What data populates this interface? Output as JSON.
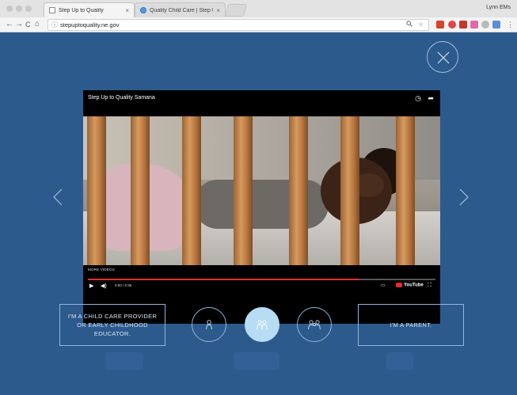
{
  "browser": {
    "tabs": [
      {
        "label": "Step Up to Quality",
        "active": true
      },
      {
        "label": "Quality Child Care | Step Up t",
        "active": false
      }
    ],
    "tab_close_glyph": "×",
    "user_name": "Lynn EMs",
    "nav": {
      "back": "←",
      "forward": "→",
      "reload": "C",
      "home": "⌂"
    },
    "info_glyph": "ⓘ",
    "url": "stepuptoquality.ne.gov",
    "menu_glyph": "⋮"
  },
  "overlay": {
    "video": {
      "title": "Step Up to Quality Samana",
      "more_videos": "MORE VIDEOS",
      "time": "0:00 / 0:35",
      "progress": 0.78,
      "youtube_label": "YouTube"
    },
    "left_button_label": "I'M A CHILD CARE PROVIDER OR EARLY CHILDHOOD EDUCATOR.",
    "right_button_label": "I'M A PARENT.",
    "active_circle": 1
  },
  "colors": {
    "page_bg": "#2d5a8c",
    "accent_light": "#b7dcf4",
    "outline": "#8fb6dc",
    "youtube_red": "#e52d27"
  }
}
